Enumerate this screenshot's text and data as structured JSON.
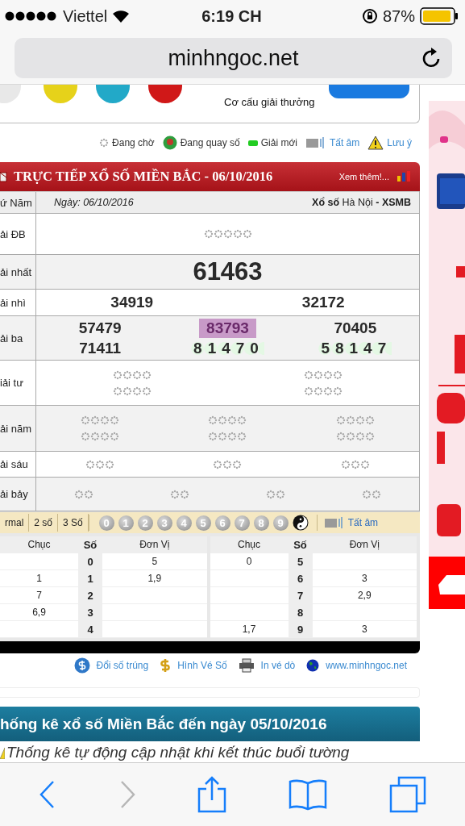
{
  "status_bar": {
    "carrier": "Viettel",
    "time": "6:19 CH",
    "battery": "87%"
  },
  "address_bar": {
    "url": "minhngoc.net"
  },
  "top_box": {
    "caption": "Cơ cấu giải thưởng"
  },
  "legend": [
    {
      "kind": "waiting",
      "label": "Đang chờ"
    },
    {
      "kind": "rolling",
      "label": "Đang quay số"
    },
    {
      "kind": "new",
      "label": "Giải mới"
    },
    {
      "kind": "sound",
      "label": "Tất âm"
    },
    {
      "kind": "warning",
      "label": "Lưu ý"
    }
  ],
  "results": {
    "title": "TRỰC TIẾP XỔ SỐ MIỀN BẮC - 06/10/2016",
    "more": "Xem thêm!...",
    "weekday": "ứ Năm",
    "date": "Ngày: 06/10/2016",
    "lottery": "**Xổ số** Hà Nội **- XSMB**",
    "prizes": [
      {
        "kind": "db",
        "label": "ải ĐB",
        "numbers": [
          {
            "kind": "waiting"
          }
        ]
      },
      {
        "kind": "nhat",
        "label": "ải nhất",
        "numbers": [
          {
            "kind": "done",
            "value": "61463"
          }
        ]
      },
      {
        "kind": "nhi",
        "label": "ải nhì",
        "numbers": [
          {
            "kind": "done",
            "value": "34919"
          },
          {
            "kind": "done",
            "value": "32172"
          }
        ]
      },
      {
        "kind": "ba",
        "label": "ải ba",
        "numbers": [
          {
            "kind": "done",
            "value": "57479"
          },
          {
            "kind": "new",
            "value": "83793"
          },
          {
            "kind": "done",
            "value": "70405"
          },
          {
            "kind": "done",
            "value": "71411"
          },
          {
            "kind": "rolling",
            "value": "81470"
          },
          {
            "kind": "rolling",
            "value": "58147"
          }
        ]
      },
      {
        "kind": "tu",
        "label": "iải tư",
        "numbers": [
          {
            "kind": "waiting"
          },
          {
            "kind": "waiting"
          },
          {
            "kind": "waiting"
          },
          {
            "kind": "waiting"
          }
        ]
      },
      {
        "kind": "nam",
        "label": "ải năm",
        "numbers": [
          {
            "kind": "waiting"
          },
          {
            "kind": "waiting"
          },
          {
            "kind": "waiting"
          },
          {
            "kind": "waiting"
          },
          {
            "kind": "waiting"
          },
          {
            "kind": "waiting"
          }
        ]
      },
      {
        "kind": "sau",
        "label": "ải sáu",
        "numbers": [
          {
            "kind": "waiting"
          },
          {
            "kind": "waiting"
          },
          {
            "kind": "waiting"
          }
        ]
      },
      {
        "kind": "bay",
        "label": "ải bảy",
        "numbers": [
          {
            "kind": "waiting"
          },
          {
            "kind": "waiting"
          },
          {
            "kind": "waiting"
          },
          {
            "kind": "waiting"
          }
        ]
      }
    ]
  },
  "toolbar": {
    "tabs": [
      {
        "label": "rmal",
        "selected": false
      },
      {
        "label": "2 số",
        "selected": false
      },
      {
        "label": "3 Số",
        "selected": false
      }
    ],
    "digits": [
      "0",
      "1",
      "2",
      "3",
      "4",
      "5",
      "6",
      "7",
      "8",
      "9"
    ],
    "mute": "Tất âm"
  },
  "loto": {
    "halves": [
      {
        "columns": [
          "Chục",
          "Số",
          "Đơn Vị"
        ],
        "rows": [
          [
            "",
            "0",
            "5"
          ],
          [
            "1",
            "1",
            "1,9"
          ],
          [
            "7",
            "2",
            ""
          ],
          [
            "6,9",
            "3",
            ""
          ],
          [
            "",
            "4",
            ""
          ]
        ]
      },
      {
        "columns": [
          "Chục",
          "Số",
          "Đơn Vị"
        ],
        "rows": [
          [
            "0",
            "5",
            ""
          ],
          [
            "",
            "6",
            "3"
          ],
          [
            "",
            "7",
            "2,9"
          ],
          [
            "",
            "8",
            ""
          ],
          [
            "1,7",
            "9",
            "3"
          ]
        ]
      }
    ]
  },
  "links": [
    {
      "kind": "coin",
      "label": "Đổi số trúng"
    },
    {
      "kind": "dollar",
      "label": "Hình Vé Số"
    },
    {
      "kind": "printer",
      "label": "In vé dò"
    },
    {
      "kind": "globe",
      "label": "www.minhngoc.net"
    }
  ],
  "stats": {
    "title": "hống kê xổ số Miền Bắc đến ngày 05/10/2016",
    "note": "Thống kê tự động cập nhật khi kết thúc buổi tường"
  },
  "bottom_toolbar": [
    {
      "kind": "back",
      "disabled": false
    },
    {
      "kind": "forward",
      "disabled": true
    },
    {
      "kind": "share",
      "disabled": false
    },
    {
      "kind": "bookmarks",
      "disabled": false
    },
    {
      "kind": "tabs",
      "disabled": false
    }
  ]
}
